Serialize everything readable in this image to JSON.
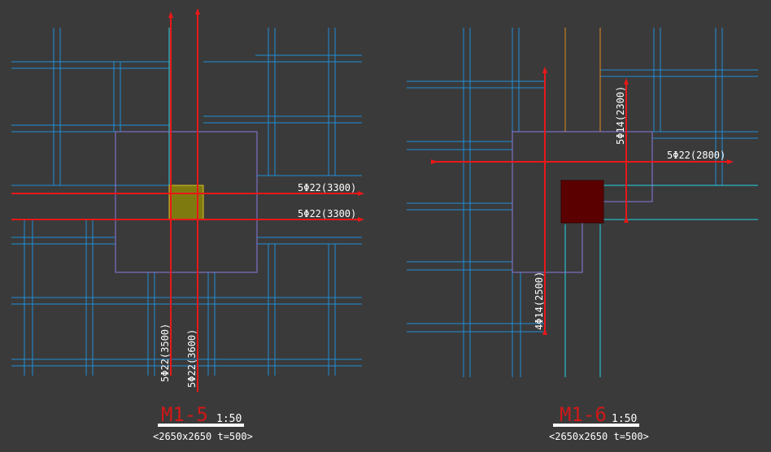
{
  "colors": {
    "background": "#3a3a3a",
    "grid_line": "#1f8fd8",
    "cyan_line": "#22d6e6",
    "rebar": "#e81818",
    "pad_outline": "#8a7ae0",
    "orange_line": "#e08a20",
    "column_m1_5": "#7f7a10",
    "column_m1_6": "#5a0000",
    "title_red": "#d01818",
    "text_white": "#ffffff"
  },
  "drawings": [
    {
      "id": "m1-5",
      "rebar_labels": {
        "horizontal_top": "5Φ22(3300)",
        "horizontal_bottom": "5Φ22(3300)",
        "vertical_left": "5Φ22(3500)",
        "vertical_right": "5Φ22(3600)"
      },
      "title": {
        "code": "M1-5",
        "scale": "1:50",
        "spec": "<2650x2650 t=500>"
      }
    },
    {
      "id": "m1-6",
      "rebar_labels": {
        "horizontal": "5Φ22(2800)",
        "vertical_right": "5Φ14(2300)",
        "vertical_left": "4Φ14(2500)"
      },
      "title": {
        "code": "M1-6",
        "scale": "1:50",
        "spec": "<2650x2650 t=500>"
      }
    }
  ]
}
